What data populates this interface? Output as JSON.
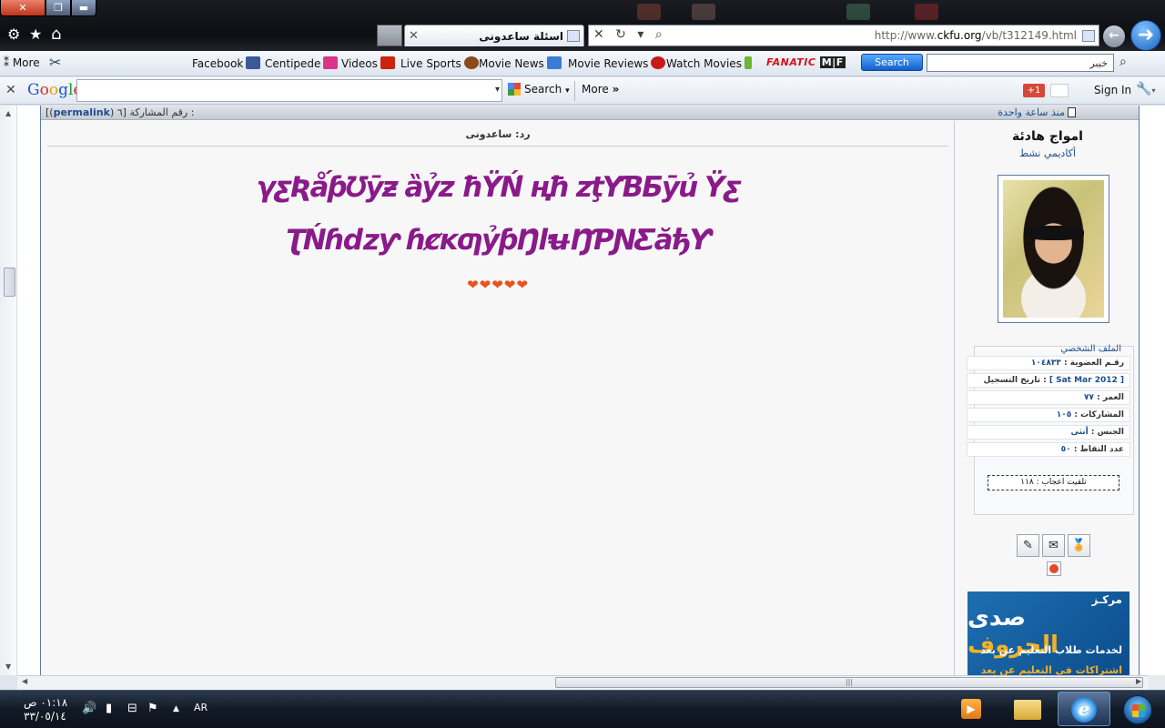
{
  "browser": {
    "tab_title": "اسئلة ساعدونى",
    "url_prefix": "http://www.",
    "url_domain": "ckfu.org",
    "url_suffix": "/vb/t312149.html",
    "nav_controls": "✕ ↻ ▾ ⌕",
    "back_glyph": "←",
    "forward_glyph": "➜"
  },
  "window_controls": {
    "close": "✕",
    "restore": "❐",
    "minimize": "▬"
  },
  "command_icons": {
    "gear": "⚙",
    "star": "★",
    "home": "⌂"
  },
  "favorites": {
    "more": "More",
    "items": [
      {
        "label": "Facebook",
        "color": "#3b5998"
      },
      {
        "label": "Centipede",
        "color": "#d9368a"
      },
      {
        "label": "Videos",
        "color": "#cc2211"
      },
      {
        "label": "Live Sports",
        "color": "#8a4a1a"
      },
      {
        "label": "Movie News",
        "color": "#3a7bd5"
      },
      {
        "label": "Movie Reviews",
        "color": "#c91a1a"
      },
      {
        "label": "Watch Movies",
        "color": "#6cb632"
      }
    ],
    "fanatic_brand": "FANATIC",
    "fanatic_mark": "M|F",
    "search_button": "Search",
    "search_value": "خيبر"
  },
  "google_toolbar": {
    "logo_parts": [
      "G",
      "o",
      "o",
      "g",
      "l",
      "e"
    ],
    "search_label": "Search",
    "more_label": "More",
    "plus_label": "+1",
    "sign_in": "Sign In",
    "close_glyph": "✕",
    "dropdown_glyph": "▾",
    "more_glyph": "»"
  },
  "post": {
    "permalink_prefix": "[(",
    "permalink_label": "permalink",
    "permalink_suffix": ") ٦]",
    "post_number_label": "رقم المشاركة :",
    "time_ago": "منذ ساعة واحدة",
    "reply_title": "رد: ساعدونى",
    "garbled_line_1": "γƹƦǻƥƱȳƶ ȁỷz ħŸŃ́ ңħ zţΥƁƂȳủ Ϋƹ",
    "garbled_line_2": "ƮŃɦǳƴ ɦȼĸƣỷƥŊŀʉŊƤƝƸăђƳ",
    "hearts": "❤❤❤❤❤"
  },
  "user": {
    "name": "امواج هادئة",
    "title": "أكاديمي نشط",
    "profile_header": "الملف الشخصي",
    "fields": [
      {
        "label": "رقـم العضوية :",
        "value": "١٠٤٨٣٣"
      },
      {
        "label": "تاريخ التسجيل :",
        "value": "[ Sat Mar 2012 ]"
      },
      {
        "label": "العمر :",
        "value": "٧٧"
      },
      {
        "label": "المشاركات :",
        "value": "١٠٥"
      },
      {
        "label": "الجنس :",
        "value": "أنثى"
      },
      {
        "label": "عدد النقاط :",
        "value": "٥٠"
      }
    ],
    "thanks": "تلقيت اعجاب : ١١٨",
    "award_icons": [
      "✎",
      "✉",
      "🏅"
    ]
  },
  "banner": {
    "line1": "مركـز",
    "line2_white": "صدى ",
    "line2_gold": "الحروف",
    "line3": "لخدمات طلاب التعليم عن بعد",
    "line4": "اشتراكات في التعليم عن بعد"
  },
  "taskbar": {
    "time": "٠١:١٨ ص",
    "date": "٣٣/٠٥/١٤",
    "language": "AR",
    "tray_icons": [
      "🔊",
      "▮",
      "⚑",
      "▲"
    ]
  },
  "scroll": {
    "up": "▲",
    "down": "▼",
    "left": "◀",
    "right": "▶",
    "grip": "|||"
  }
}
